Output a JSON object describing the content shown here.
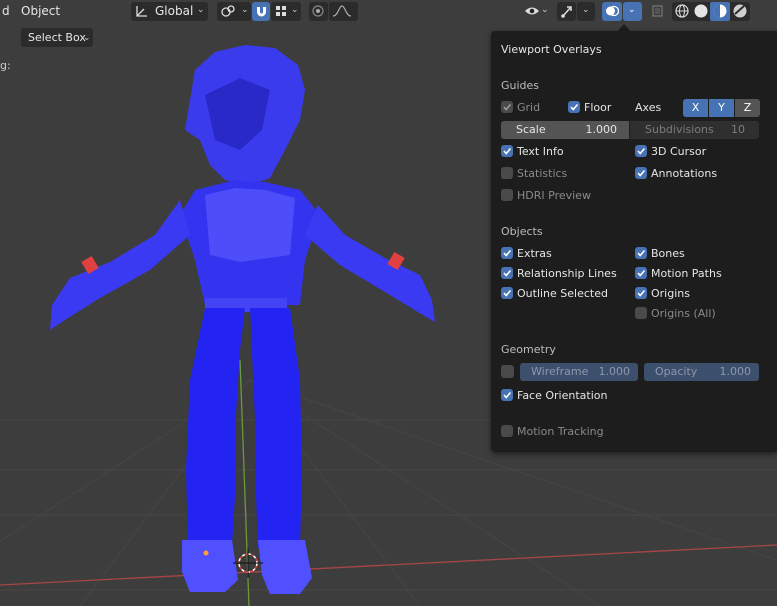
{
  "header": {
    "menu_left": "d",
    "menu_object": "Object",
    "transform_orientation": "Global",
    "snap_label": "g:",
    "select_mode": "Select Box"
  },
  "overlay_panel": {
    "title": "Viewport Overlays",
    "guides": {
      "heading": "Guides",
      "grid": "Grid",
      "floor": "Floor",
      "axes": "Axes",
      "axis_x": "X",
      "axis_y": "Y",
      "axis_z": "Z",
      "scale_label": "Scale",
      "scale_value": "1.000",
      "subdivisions_label": "Subdivisions",
      "subdivisions_value": "10",
      "text_info": "Text Info",
      "cursor_3d": "3D Cursor",
      "statistics": "Statistics",
      "annotations": "Annotations",
      "hdri_preview": "HDRI Preview"
    },
    "objects": {
      "heading": "Objects",
      "extras": "Extras",
      "bones": "Bones",
      "relationship_lines": "Relationship Lines",
      "motion_paths": "Motion Paths",
      "outline_selected": "Outline Selected",
      "origins": "Origins",
      "origins_all": "Origins (All)"
    },
    "geometry": {
      "heading": "Geometry",
      "wireframe_label": "Wireframe",
      "wireframe_value": "1.000",
      "opacity_label": "Opacity",
      "opacity_value": "1.000",
      "face_orientation": "Face Orientation"
    },
    "motion_tracking": "Motion Tracking"
  },
  "colors": {
    "accent": "#4772b3",
    "panel_bg": "#1d1d1d",
    "viewport_bg": "#3d3d3d",
    "face_orientation_blue": "#2a2aff"
  }
}
